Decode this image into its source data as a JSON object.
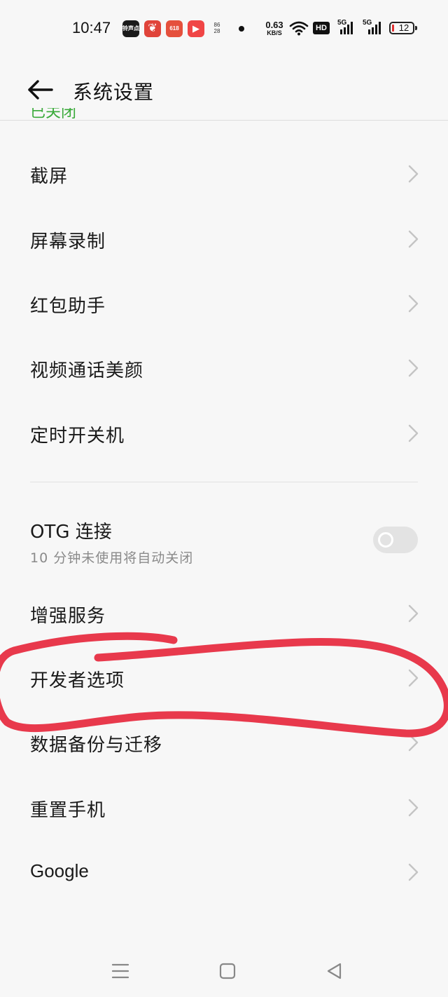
{
  "status_bar": {
    "time": "10:47",
    "app_icons": [
      {
        "name": "app-icon-1",
        "text": "铃声点",
        "color": "#1a1a1a"
      },
      {
        "name": "app-icon-2",
        "text": "❦",
        "color": "#e0443a"
      },
      {
        "name": "app-icon-3",
        "text": "618",
        "color": "#e5503c"
      },
      {
        "name": "app-icon-4",
        "text": "▶",
        "color": "#f04545"
      }
    ],
    "small_badge_top": "86",
    "small_badge_bottom": "28",
    "net_speed_value": "0.63",
    "net_speed_unit": "KB/S",
    "hd_label": "HD",
    "signal1_label": "5G",
    "signal2_label": "5G",
    "battery_level": "12",
    "battery_color": "#e03030"
  },
  "header": {
    "back_icon": "arrow-left-icon",
    "title": "系统设置"
  },
  "peek_text": "已关闭",
  "menu": {
    "items": [
      {
        "name": "menu-item-screenshot",
        "label": "截屏"
      },
      {
        "name": "menu-item-screen-record",
        "label": "屏幕录制"
      },
      {
        "name": "menu-item-red-envelope",
        "label": "红包助手"
      },
      {
        "name": "menu-item-video-beauty",
        "label": "视频通话美颜"
      },
      {
        "name": "menu-item-scheduled-power",
        "label": "定时开关机"
      }
    ],
    "otg": {
      "label": "OTG 连接",
      "subtitle": "10 分钟未使用将自动关闭",
      "enabled": false
    },
    "items2": [
      {
        "name": "menu-item-enhanced-services",
        "label": "增强服务"
      },
      {
        "name": "menu-item-developer-options",
        "label": "开发者选项"
      },
      {
        "name": "menu-item-backup-migrate",
        "label": "数据备份与迁移"
      },
      {
        "name": "menu-item-reset-phone",
        "label": "重置手机"
      },
      {
        "name": "menu-item-google",
        "label": "Google"
      }
    ]
  },
  "annotation": {
    "color": "#e8394c",
    "marks": "developer-options-circle"
  },
  "nav_bar": {
    "menu_icon": "menu-lines-icon",
    "home_icon": "square-home-icon",
    "back_icon": "triangle-back-icon"
  }
}
